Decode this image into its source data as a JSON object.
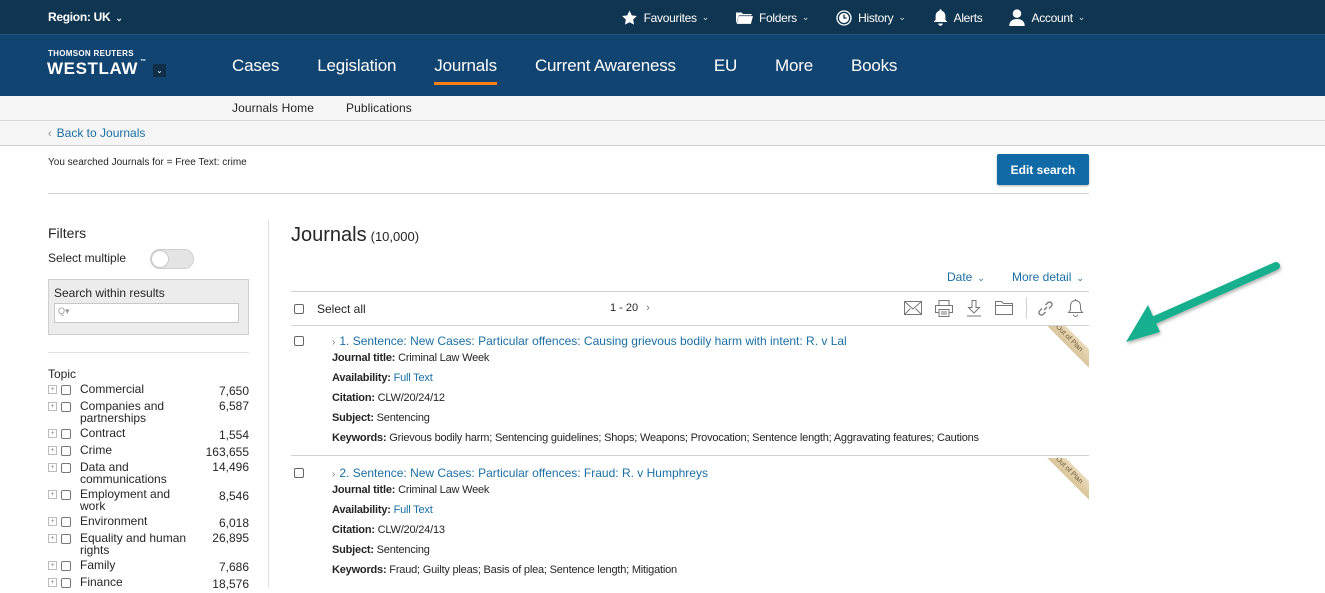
{
  "utility_bar": {
    "region": "Region: UK",
    "items": [
      {
        "label": "Favourites",
        "icon": "star-icon",
        "dropdown": true
      },
      {
        "label": "Folders",
        "icon": "folder-icon",
        "dropdown": true
      },
      {
        "label": "History",
        "icon": "clock-icon",
        "dropdown": true
      },
      {
        "label": "Alerts",
        "icon": "bell-icon",
        "dropdown": false
      },
      {
        "label": "Account",
        "icon": "user-icon",
        "dropdown": true
      }
    ]
  },
  "brand": {
    "top": "THOMSON REUTERS",
    "main": "WESTLAW",
    "tm": "™"
  },
  "nav": {
    "tabs": [
      "Cases",
      "Legislation",
      "Journals",
      "Current Awareness",
      "EU",
      "More",
      "Books"
    ],
    "active": "Journals"
  },
  "subnav": {
    "items": [
      "Journals Home",
      "Publications"
    ]
  },
  "back_link": "Back to Journals",
  "search_summary": "You searched Journals for = Free Text: crime",
  "edit_search": "Edit search",
  "sidebar": {
    "title": "Filters",
    "select_multiple": "Select multiple",
    "select_multiple_on": false,
    "search_within_label": "Search within results",
    "search_within_value": "",
    "topic_title": "Topic",
    "topics": [
      {
        "label": "Commercial",
        "count": "7,650"
      },
      {
        "label": "Companies and partnerships",
        "count": "6,587"
      },
      {
        "label": "Contract",
        "count": "1,554"
      },
      {
        "label": "Crime",
        "count": "163,655"
      },
      {
        "label": "Data and communications",
        "count": "14,496"
      },
      {
        "label": "Employment and work",
        "count": "8,546"
      },
      {
        "label": "Environment",
        "count": "6,018"
      },
      {
        "label": "Equality and human rights",
        "count": "26,895"
      },
      {
        "label": "Family",
        "count": "7,686"
      },
      {
        "label": "Finance",
        "count": "18,576"
      }
    ]
  },
  "results": {
    "title": "Journals",
    "count": "(10,000)",
    "sort": "Date",
    "detail": "More detail",
    "select_all": "Select all",
    "range": "1 - 20",
    "items": [
      {
        "number": "1.",
        "title": "Sentence: New Cases: Particular offences: Causing grievous bodily harm with intent: R. v Lal",
        "journal_title_label": "Journal title:",
        "journal_title": "Criminal Law Week",
        "availability_label": "Availability:",
        "availability": "Full Text",
        "citation_label": "Citation:",
        "citation": "CLW/20/24/12",
        "subject_label": "Subject:",
        "subject": "Sentencing",
        "keywords_label": "Keywords:",
        "keywords": "Grievous bodily harm; Sentencing guidelines; Shops; Weapons; Provocation; Sentence length; Aggravating features; Cautions",
        "ribbon": "Out of Plan"
      },
      {
        "number": "2.",
        "title": "Sentence: New Cases: Particular offences: Fraud: R. v Humphreys",
        "journal_title_label": "Journal title:",
        "journal_title": "Criminal Law Week",
        "availability_label": "Availability:",
        "availability": "Full Text",
        "citation_label": "Citation:",
        "citation": "CLW/20/24/13",
        "subject_label": "Subject:",
        "subject": "Sentencing",
        "keywords_label": "Keywords:",
        "keywords": "Fraud; Guilty pleas; Basis of plea; Sentence length; Mitigation",
        "ribbon": "Out of Plan"
      }
    ]
  },
  "colors": {
    "accent_orange": "#fa7f17",
    "link_blue": "#1a6fa3",
    "nav_blue": "#114470",
    "annotation_arrow": "#17b08e"
  }
}
